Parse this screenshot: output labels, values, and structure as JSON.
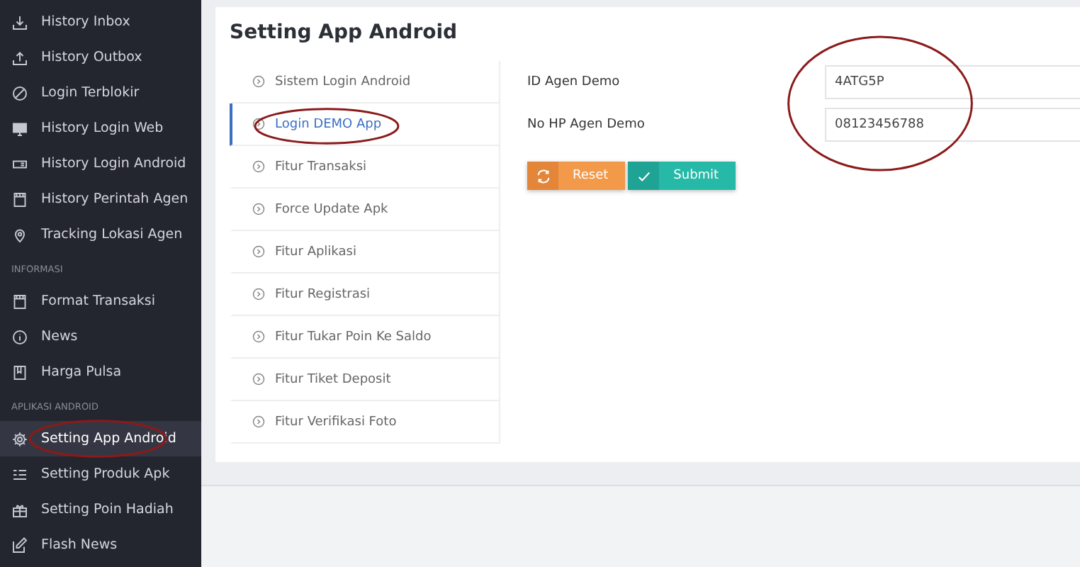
{
  "sidebar": {
    "sections": [
      {
        "items": [
          {
            "label": "History Inbox",
            "selected": false,
            "circled": false
          },
          {
            "label": "History Outbox",
            "selected": false,
            "circled": false
          },
          {
            "label": "Login Terblokir",
            "selected": false,
            "circled": false
          },
          {
            "label": "History Login Web",
            "selected": false,
            "circled": false
          },
          {
            "label": "History Login Android",
            "selected": false,
            "circled": false
          },
          {
            "label": "History Perintah Agen",
            "selected": false,
            "circled": false
          },
          {
            "label": "Tracking Lokasi Agen",
            "selected": false,
            "circled": false
          }
        ]
      },
      {
        "heading": "INFORMASI",
        "items": [
          {
            "label": "Format Transaksi",
            "selected": false,
            "circled": false
          },
          {
            "label": "News",
            "selected": false,
            "circled": false
          },
          {
            "label": "Harga Pulsa",
            "selected": false,
            "circled": false
          }
        ]
      },
      {
        "heading": "APLIKASI ANDROID",
        "items": [
          {
            "label": "Setting App Android",
            "selected": true,
            "circled": true
          },
          {
            "label": "Setting Produk Apk",
            "selected": false,
            "circled": false
          },
          {
            "label": "Setting Poin Hadiah",
            "selected": false,
            "circled": false
          },
          {
            "label": "Flash News",
            "selected": false,
            "circled": false
          }
        ]
      }
    ]
  },
  "page": {
    "title": "Setting App Android",
    "tabs": [
      {
        "label": "Sistem Login Android",
        "selected": false,
        "circled": false
      },
      {
        "label": "Login DEMO App",
        "selected": true,
        "circled": true
      },
      {
        "label": "Fitur Transaksi",
        "selected": false,
        "circled": false
      },
      {
        "label": "Force Update Apk",
        "selected": false,
        "circled": false
      },
      {
        "label": "Fitur Aplikasi",
        "selected": false,
        "circled": false
      },
      {
        "label": "Fitur Registrasi",
        "selected": false,
        "circled": false
      },
      {
        "label": "Fitur Tukar Poin Ke Saldo",
        "selected": false,
        "circled": false
      },
      {
        "label": "Fitur Tiket Deposit",
        "selected": false,
        "circled": false
      },
      {
        "label": "Fitur Verifikasi Foto",
        "selected": false,
        "circled": false
      }
    ],
    "fields": [
      {
        "label": "ID Agen Demo",
        "value": "4ATG5P"
      },
      {
        "label": "No HP Agen Demo",
        "value": "08123456788"
      }
    ],
    "fields_circled": true,
    "buttons": [
      {
        "label": "Reset",
        "kind": "reset"
      },
      {
        "label": "Submit",
        "kind": "submit"
      }
    ]
  }
}
